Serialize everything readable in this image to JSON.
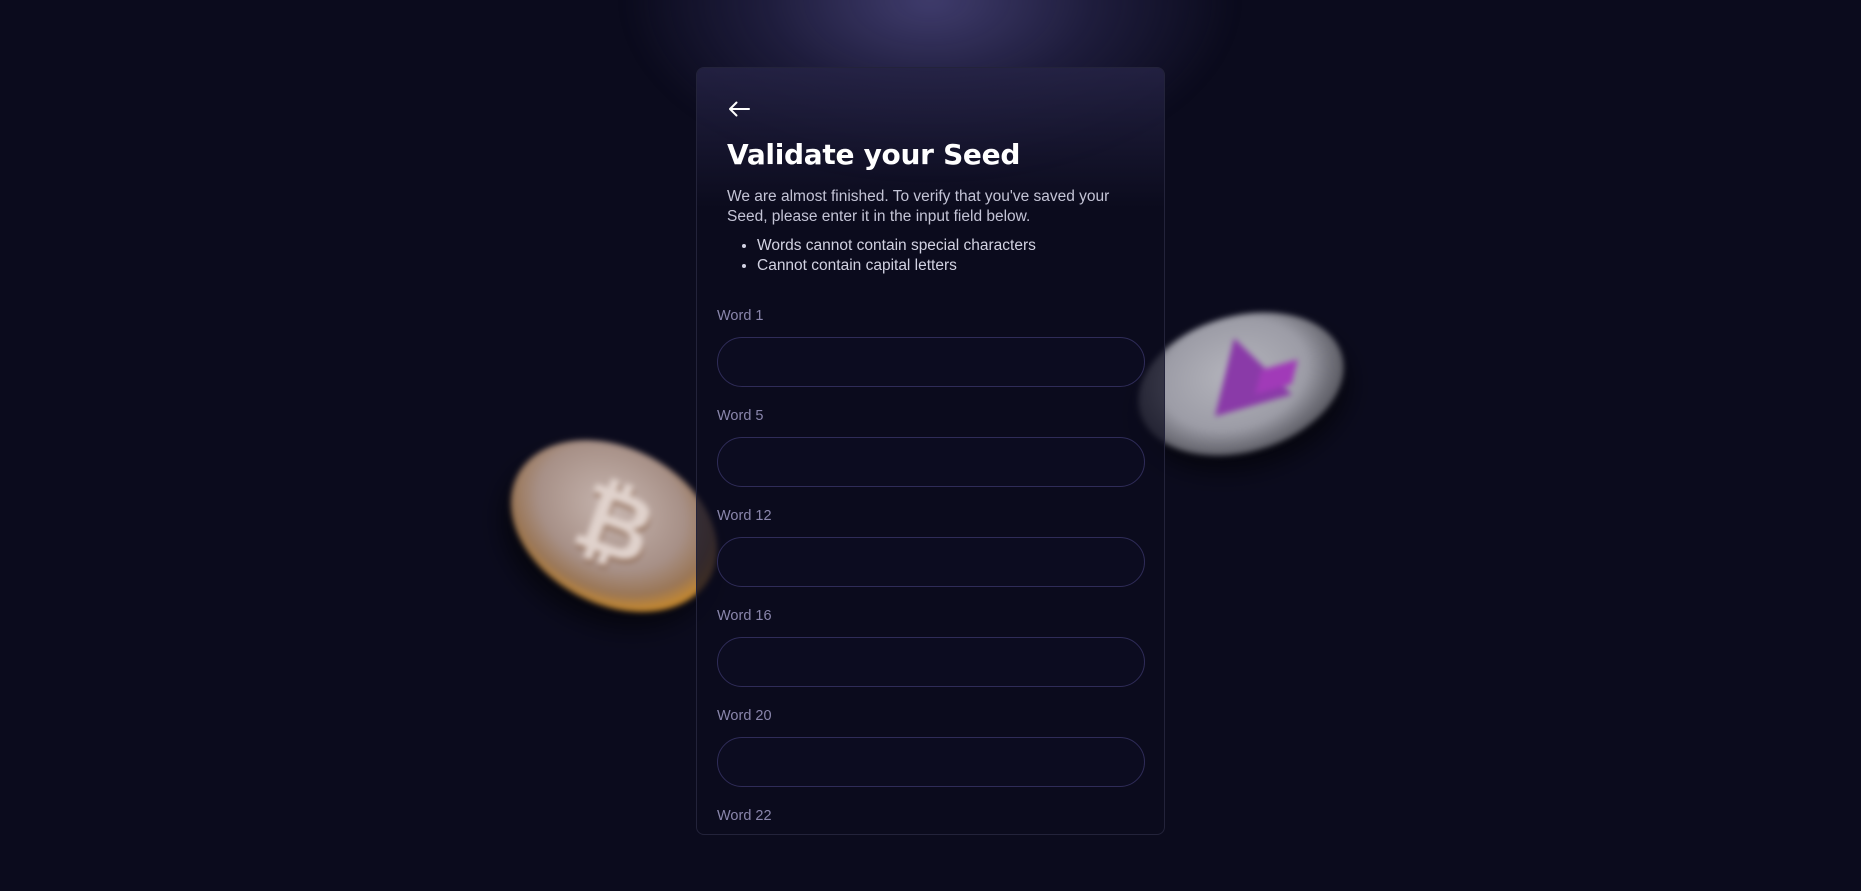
{
  "page": {
    "title": "Validate your Seed",
    "description": "We are almost finished. To verify that you've saved your Seed, please enter it in the input field below.",
    "rules": [
      "Words cannot contain special characters",
      "Cannot contain capital letters"
    ]
  },
  "fields": [
    {
      "label": "Word 1",
      "value": "",
      "placeholder": ""
    },
    {
      "label": "Word 5",
      "value": "",
      "placeholder": ""
    },
    {
      "label": "Word 12",
      "value": "",
      "placeholder": ""
    },
    {
      "label": "Word 16",
      "value": "",
      "placeholder": ""
    },
    {
      "label": "Word 20",
      "value": "",
      "placeholder": ""
    },
    {
      "label": "Word 22",
      "value": "",
      "placeholder": ""
    }
  ],
  "icons": {
    "back": "arrow-left-icon",
    "coin_left": "bitcoin-coin-icon",
    "coin_right": "ethereum-coin-icon"
  },
  "colors": {
    "background": "#0b0b1d",
    "card_border": "#23233a",
    "input_border": "#2f2c58",
    "label": "#8a86ac",
    "title": "#ffffff"
  }
}
